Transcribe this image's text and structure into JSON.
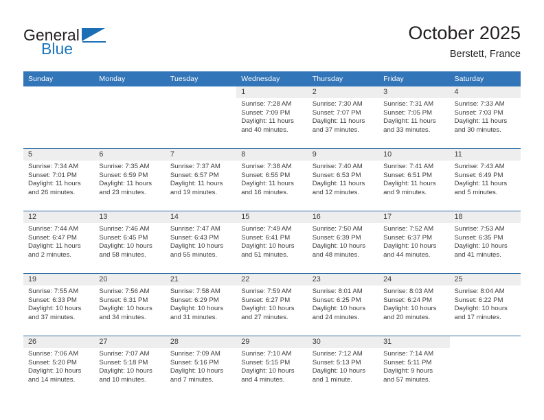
{
  "brand": {
    "name_part1": "General",
    "name_part2": "Blue",
    "logo_icon": "triangle-flag-icon"
  },
  "header": {
    "title": "October 2025",
    "subtitle": "Berstett, France"
  },
  "colors": {
    "header_band": "#3275b8",
    "row_divider": "#2e6da4",
    "daynum_band": "#eeeeee",
    "brand_blue": "#1c75bc",
    "text": "#3b3b3b"
  },
  "weekdays": [
    "Sunday",
    "Monday",
    "Tuesday",
    "Wednesday",
    "Thursday",
    "Friday",
    "Saturday"
  ],
  "weeks": [
    [
      {
        "day": "",
        "sunrise": "",
        "sunset": "",
        "daylight1": "",
        "daylight2": ""
      },
      {
        "day": "",
        "sunrise": "",
        "sunset": "",
        "daylight1": "",
        "daylight2": ""
      },
      {
        "day": "",
        "sunrise": "",
        "sunset": "",
        "daylight1": "",
        "daylight2": ""
      },
      {
        "day": "1",
        "sunrise": "Sunrise: 7:28 AM",
        "sunset": "Sunset: 7:09 PM",
        "daylight1": "Daylight: 11 hours",
        "daylight2": "and 40 minutes."
      },
      {
        "day": "2",
        "sunrise": "Sunrise: 7:30 AM",
        "sunset": "Sunset: 7:07 PM",
        "daylight1": "Daylight: 11 hours",
        "daylight2": "and 37 minutes."
      },
      {
        "day": "3",
        "sunrise": "Sunrise: 7:31 AM",
        "sunset": "Sunset: 7:05 PM",
        "daylight1": "Daylight: 11 hours",
        "daylight2": "and 33 minutes."
      },
      {
        "day": "4",
        "sunrise": "Sunrise: 7:33 AM",
        "sunset": "Sunset: 7:03 PM",
        "daylight1": "Daylight: 11 hours",
        "daylight2": "and 30 minutes."
      }
    ],
    [
      {
        "day": "5",
        "sunrise": "Sunrise: 7:34 AM",
        "sunset": "Sunset: 7:01 PM",
        "daylight1": "Daylight: 11 hours",
        "daylight2": "and 26 minutes."
      },
      {
        "day": "6",
        "sunrise": "Sunrise: 7:35 AM",
        "sunset": "Sunset: 6:59 PM",
        "daylight1": "Daylight: 11 hours",
        "daylight2": "and 23 minutes."
      },
      {
        "day": "7",
        "sunrise": "Sunrise: 7:37 AM",
        "sunset": "Sunset: 6:57 PM",
        "daylight1": "Daylight: 11 hours",
        "daylight2": "and 19 minutes."
      },
      {
        "day": "8",
        "sunrise": "Sunrise: 7:38 AM",
        "sunset": "Sunset: 6:55 PM",
        "daylight1": "Daylight: 11 hours",
        "daylight2": "and 16 minutes."
      },
      {
        "day": "9",
        "sunrise": "Sunrise: 7:40 AM",
        "sunset": "Sunset: 6:53 PM",
        "daylight1": "Daylight: 11 hours",
        "daylight2": "and 12 minutes."
      },
      {
        "day": "10",
        "sunrise": "Sunrise: 7:41 AM",
        "sunset": "Sunset: 6:51 PM",
        "daylight1": "Daylight: 11 hours",
        "daylight2": "and 9 minutes."
      },
      {
        "day": "11",
        "sunrise": "Sunrise: 7:43 AM",
        "sunset": "Sunset: 6:49 PM",
        "daylight1": "Daylight: 11 hours",
        "daylight2": "and 5 minutes."
      }
    ],
    [
      {
        "day": "12",
        "sunrise": "Sunrise: 7:44 AM",
        "sunset": "Sunset: 6:47 PM",
        "daylight1": "Daylight: 11 hours",
        "daylight2": "and 2 minutes."
      },
      {
        "day": "13",
        "sunrise": "Sunrise: 7:46 AM",
        "sunset": "Sunset: 6:45 PM",
        "daylight1": "Daylight: 10 hours",
        "daylight2": "and 58 minutes."
      },
      {
        "day": "14",
        "sunrise": "Sunrise: 7:47 AM",
        "sunset": "Sunset: 6:43 PM",
        "daylight1": "Daylight: 10 hours",
        "daylight2": "and 55 minutes."
      },
      {
        "day": "15",
        "sunrise": "Sunrise: 7:49 AM",
        "sunset": "Sunset: 6:41 PM",
        "daylight1": "Daylight: 10 hours",
        "daylight2": "and 51 minutes."
      },
      {
        "day": "16",
        "sunrise": "Sunrise: 7:50 AM",
        "sunset": "Sunset: 6:39 PM",
        "daylight1": "Daylight: 10 hours",
        "daylight2": "and 48 minutes."
      },
      {
        "day": "17",
        "sunrise": "Sunrise: 7:52 AM",
        "sunset": "Sunset: 6:37 PM",
        "daylight1": "Daylight: 10 hours",
        "daylight2": "and 44 minutes."
      },
      {
        "day": "18",
        "sunrise": "Sunrise: 7:53 AM",
        "sunset": "Sunset: 6:35 PM",
        "daylight1": "Daylight: 10 hours",
        "daylight2": "and 41 minutes."
      }
    ],
    [
      {
        "day": "19",
        "sunrise": "Sunrise: 7:55 AM",
        "sunset": "Sunset: 6:33 PM",
        "daylight1": "Daylight: 10 hours",
        "daylight2": "and 37 minutes."
      },
      {
        "day": "20",
        "sunrise": "Sunrise: 7:56 AM",
        "sunset": "Sunset: 6:31 PM",
        "daylight1": "Daylight: 10 hours",
        "daylight2": "and 34 minutes."
      },
      {
        "day": "21",
        "sunrise": "Sunrise: 7:58 AM",
        "sunset": "Sunset: 6:29 PM",
        "daylight1": "Daylight: 10 hours",
        "daylight2": "and 31 minutes."
      },
      {
        "day": "22",
        "sunrise": "Sunrise: 7:59 AM",
        "sunset": "Sunset: 6:27 PM",
        "daylight1": "Daylight: 10 hours",
        "daylight2": "and 27 minutes."
      },
      {
        "day": "23",
        "sunrise": "Sunrise: 8:01 AM",
        "sunset": "Sunset: 6:25 PM",
        "daylight1": "Daylight: 10 hours",
        "daylight2": "and 24 minutes."
      },
      {
        "day": "24",
        "sunrise": "Sunrise: 8:03 AM",
        "sunset": "Sunset: 6:24 PM",
        "daylight1": "Daylight: 10 hours",
        "daylight2": "and 20 minutes."
      },
      {
        "day": "25",
        "sunrise": "Sunrise: 8:04 AM",
        "sunset": "Sunset: 6:22 PM",
        "daylight1": "Daylight: 10 hours",
        "daylight2": "and 17 minutes."
      }
    ],
    [
      {
        "day": "26",
        "sunrise": "Sunrise: 7:06 AM",
        "sunset": "Sunset: 5:20 PM",
        "daylight1": "Daylight: 10 hours",
        "daylight2": "and 14 minutes."
      },
      {
        "day": "27",
        "sunrise": "Sunrise: 7:07 AM",
        "sunset": "Sunset: 5:18 PM",
        "daylight1": "Daylight: 10 hours",
        "daylight2": "and 10 minutes."
      },
      {
        "day": "28",
        "sunrise": "Sunrise: 7:09 AM",
        "sunset": "Sunset: 5:16 PM",
        "daylight1": "Daylight: 10 hours",
        "daylight2": "and 7 minutes."
      },
      {
        "day": "29",
        "sunrise": "Sunrise: 7:10 AM",
        "sunset": "Sunset: 5:15 PM",
        "daylight1": "Daylight: 10 hours",
        "daylight2": "and 4 minutes."
      },
      {
        "day": "30",
        "sunrise": "Sunrise: 7:12 AM",
        "sunset": "Sunset: 5:13 PM",
        "daylight1": "Daylight: 10 hours",
        "daylight2": "and 1 minute."
      },
      {
        "day": "31",
        "sunrise": "Sunrise: 7:14 AM",
        "sunset": "Sunset: 5:11 PM",
        "daylight1": "Daylight: 9 hours",
        "daylight2": "and 57 minutes."
      },
      {
        "day": "",
        "sunrise": "",
        "sunset": "",
        "daylight1": "",
        "daylight2": ""
      }
    ]
  ]
}
